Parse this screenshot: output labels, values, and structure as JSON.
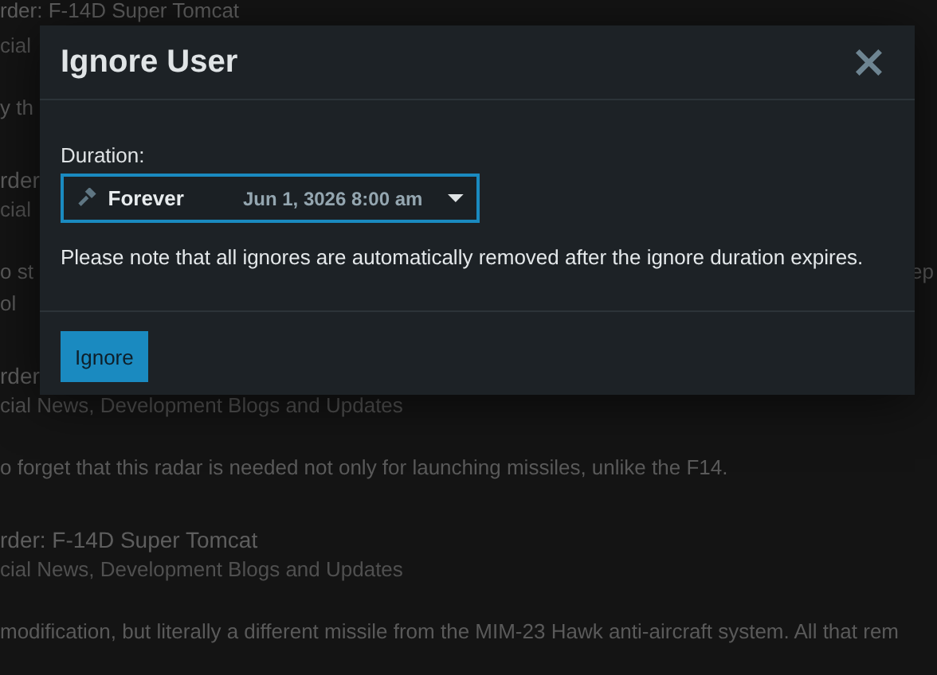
{
  "background_posts": [
    {
      "title": "rder: F-14D Super Tomcat",
      "forum": "cial",
      "body_lines": [
        {
          "left": "y th"
        }
      ]
    },
    {
      "title": "rder",
      "forum": "cial",
      "body_lines": [
        {
          "left": "o st",
          "right": "ep"
        },
        {
          "left": "ol"
        }
      ]
    },
    {
      "title": "rder",
      "forum": "cial News, Development Blogs and Updates",
      "body_lines": [
        {
          "left": "o forget that this radar is needed not only for launching missiles, unlike the F14."
        }
      ]
    },
    {
      "title": "rder: F-14D Super Tomcat",
      "forum": "cial News, Development Blogs and Updates",
      "body_lines": [
        {
          "left": "modification, but literally a different missile from the MIM-23 Hawk anti-aircraft system. All that rem"
        }
      ]
    }
  ],
  "dialog": {
    "title": "Ignore User",
    "close": "×",
    "duration_label": "Duration:",
    "duration_select": {
      "value": "Forever",
      "date": "Jun 1, 3026 8:00 am"
    },
    "note": "Please note that all ignores are automatically removed after the ignore duration expires.",
    "buttons": [
      "Ignore"
    ]
  }
}
